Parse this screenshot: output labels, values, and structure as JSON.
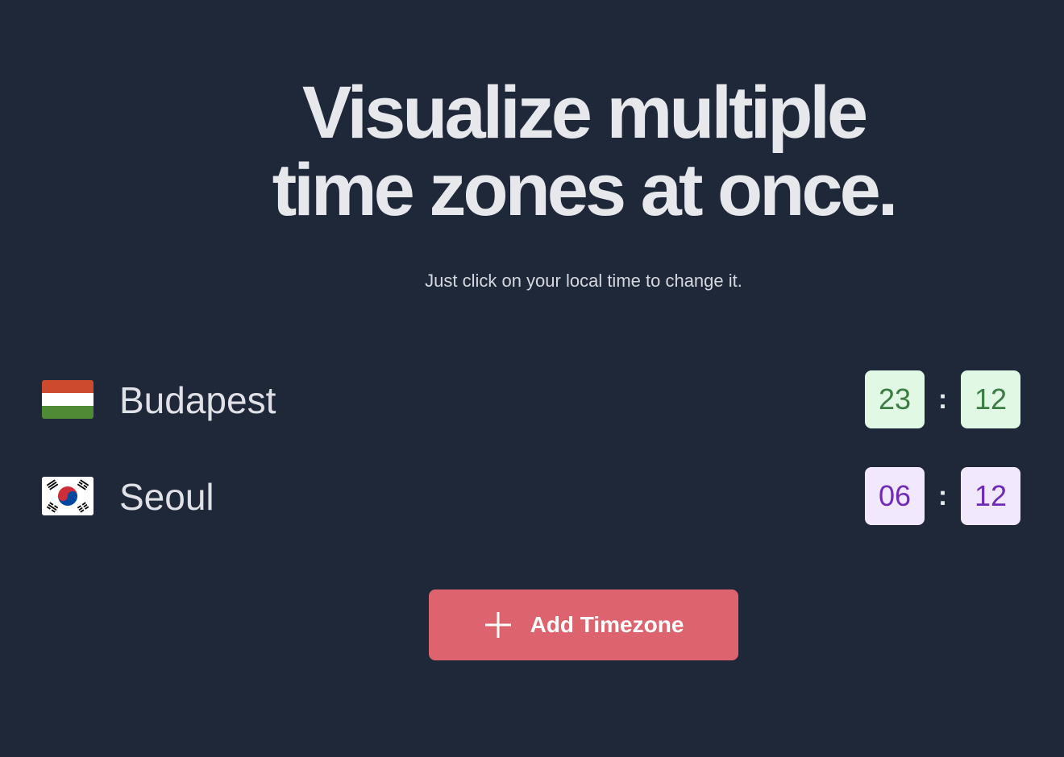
{
  "hero": {
    "line1": "Visualize multiple",
    "line2": "time zones at once.",
    "subtitle": "Just click on your local time to change it."
  },
  "timezones": [
    {
      "city": "Budapest",
      "flag": "hungary-flag-icon",
      "hours": "23",
      "minutes": "12",
      "separator": ":",
      "color": "#3b7d42"
    },
    {
      "city": "Seoul",
      "flag": "south-korea-flag-icon",
      "hours": "06",
      "minutes": "12",
      "separator": ":",
      "color": "#6f2ab6"
    }
  ],
  "add_button": {
    "label": "Add Timezone",
    "icon": "plus-icon",
    "color": "#dd646e"
  }
}
